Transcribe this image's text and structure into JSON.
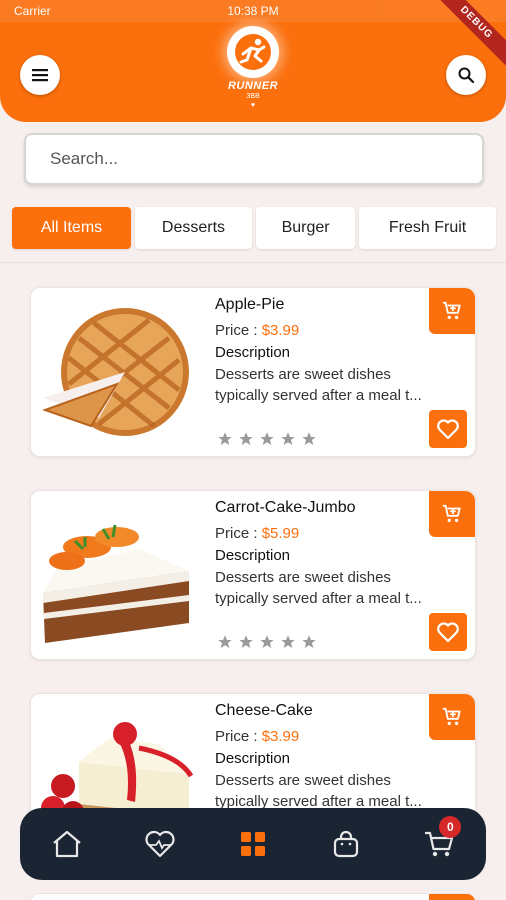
{
  "status_bar": {
    "left": "Carrier",
    "time": "10:38 PM"
  },
  "header": {
    "logo_word": "RUNNER",
    "logo_sub1": "ЗВВ",
    "logo_sub2": "♥",
    "debug_label": "DEBUG",
    "menu_icon": "hamburger-icon",
    "search_icon": "search-icon",
    "accent": "#fb6f0c"
  },
  "search": {
    "placeholder": "Search...",
    "value": ""
  },
  "tabs": [
    {
      "label": "All Items",
      "active": true
    },
    {
      "label": "Desserts",
      "active": false
    },
    {
      "label": "Burger",
      "active": false
    },
    {
      "label": "Fresh Fruit",
      "active": false
    }
  ],
  "products": [
    {
      "name": "Apple-Pie",
      "price_label": "Price : ",
      "price": "$3.99",
      "desc_title": "Description",
      "desc_line1": "Desserts are sweet dishes",
      "desc_line2": "typically served after a meal t...",
      "rating": 0,
      "image": "apple-pie"
    },
    {
      "name": "Carrot-Cake-Jumbo",
      "price_label": "Price : ",
      "price": "$5.99",
      "desc_title": "Description",
      "desc_line1": "Desserts are sweet dishes",
      "desc_line2": "typically served after a meal t...",
      "rating": 0,
      "image": "carrot-cake"
    },
    {
      "name": "Cheese-Cake",
      "price_label": "Price : ",
      "price": "$3.99",
      "desc_title": "Description",
      "desc_line1": "Desserts are sweet dishes",
      "desc_line2": "typically served after a meal t...",
      "rating": 0,
      "image": "cheese-cake"
    }
  ],
  "bottom_nav": {
    "items": [
      "home-icon",
      "favorites-icon",
      "grid-icon",
      "bag-icon",
      "cart-icon"
    ],
    "active": "grid-icon",
    "cart_count": "0",
    "background": "#1b2433"
  }
}
